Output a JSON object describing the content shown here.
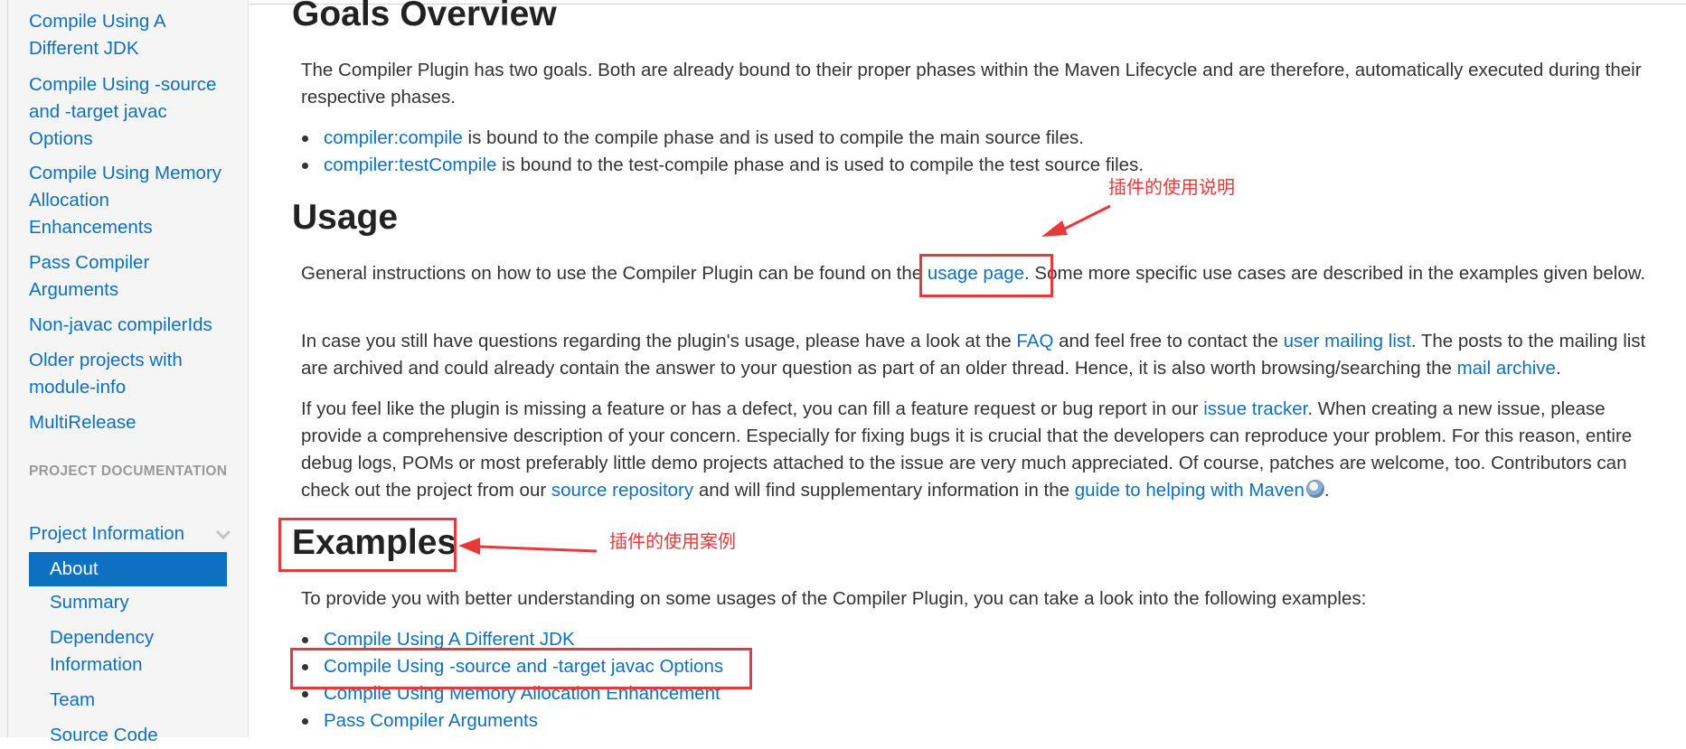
{
  "sidebar": {
    "links": [
      "Compile Using A Different JDK",
      "Compile Using -source and -target javac Options",
      "Compile Using Memory Allocation Enhancements",
      "Pass Compiler Arguments",
      "Non-javac compilerIds",
      "Older projects with module-info",
      "MultiRelease"
    ],
    "section_header": "PROJECT DOCUMENTATION",
    "project_info": "Project Information",
    "sub_items": [
      "About",
      "Summary",
      "Dependency Information",
      "Team",
      "Source Code"
    ]
  },
  "main": {
    "goals": {
      "heading": "Goals Overview",
      "intro": "The Compiler Plugin has two goals. Both are already bound to their proper phases within the Maven Lifecycle and are therefore, automatically executed during their respective phases.",
      "items": [
        {
          "link": "compiler:compile",
          "text": " is bound to the compile phase and is used to compile the main source files."
        },
        {
          "link": "compiler:testCompile",
          "text": " is bound to the test-compile phase and is used to compile the test source files."
        }
      ]
    },
    "usage": {
      "heading": "Usage",
      "p1_before": "General instructions on how to use the Compiler Plugin can be found on the ",
      "p1_link": "usage page",
      "p1_after": ". Some more specific use cases are described in the examples given below.",
      "p2_a": "In case you still have questions regarding the plugin's usage, please have a look at the ",
      "p2_link_faq": "FAQ",
      "p2_b": " and feel free to contact the ",
      "p2_link_list": "user mailing list",
      "p2_c": ". The posts to the mailing list are archived and could already contain the answer to your question as part of an older thread. Hence, it is also worth browsing/searching the ",
      "p2_link_archive": "mail archive",
      "p2_d": ".",
      "p3_a": "If you feel like the plugin is missing a feature or has a defect, you can fill a feature request or bug report in our ",
      "p3_link_tracker": "issue tracker",
      "p3_b": ". When creating a new issue, please provide a comprehensive description of your concern. Especially for fixing bugs it is crucial that the developers can reproduce your problem. For this reason, entire debug logs, POMs or most preferably little demo projects attached to the issue are very much appreciated. Of course, patches are welcome, too. Contributors can check out the project from our ",
      "p3_link_repo": "source repository",
      "p3_c": " and will find supplementary information in the ",
      "p3_link_guide": "guide to helping with Maven",
      "p3_d": "."
    },
    "examples": {
      "heading": "Examples",
      "intro": "To provide you with better understanding on some usages of the Compiler Plugin, you can take a look into the following examples:",
      "items": [
        "Compile Using A Different JDK",
        "Compile Using -source and -target javac Options",
        "Compile Using Memory Allocation Enhancement",
        "Pass Compiler Arguments"
      ]
    }
  },
  "annotations": {
    "usage_note": "插件的使用说明",
    "examples_note": "插件的使用案例",
    "color": "#e8393a"
  },
  "colors": {
    "link": "#0e70c0",
    "active_bg": "#0e70c0",
    "sidebar_bg": "#f5f5f5"
  }
}
